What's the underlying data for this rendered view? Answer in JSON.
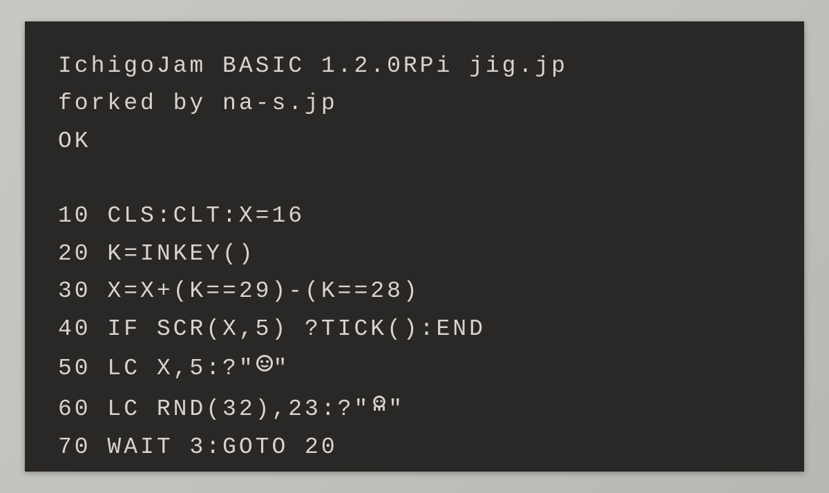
{
  "terminal": {
    "header_line1": "IchigoJam BASIC 1.2.0RPi jig.jp",
    "header_line2": "forked by na-s.jp",
    "prompt": "OK",
    "code_lines": [
      "10 CLS:CLT:X=16",
      "20 K=INKEY()",
      "30 X=X+(K==29)-(K==28)",
      "40 IF SCR(X,5) ?TICK():END",
      "50 LC X,5:?\"",
      "60 LC RND(32),23:?\"",
      "70 WAIT 3:GOTO 20"
    ],
    "line50_end": "\"",
    "line60_end": "\""
  }
}
